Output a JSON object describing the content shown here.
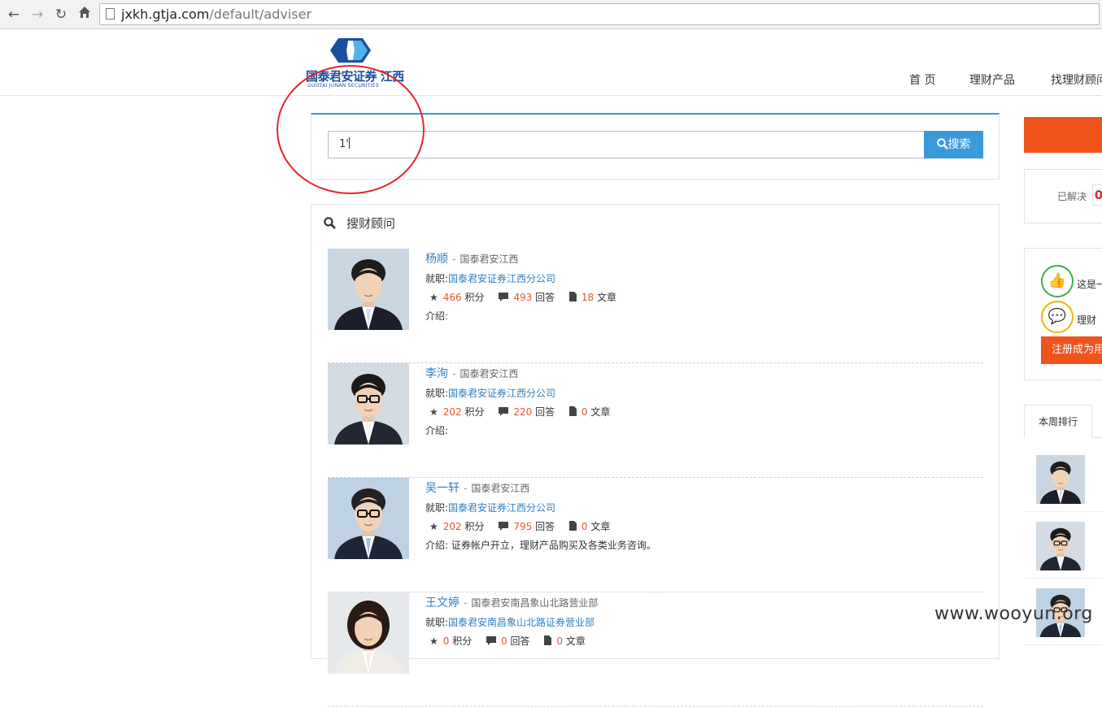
{
  "browser": {
    "url_host": "jxkh.gtja.com",
    "url_path": "/default/adviser"
  },
  "header": {
    "logo_name": "国泰君安证券 江西",
    "logo_sub": "GUOTAI JUNAN SECURITIES",
    "nav": [
      "首 页",
      "理财产品",
      "找理财顾问"
    ]
  },
  "search": {
    "value": "1'",
    "button_label": "搜索"
  },
  "results": {
    "title": "搜财顾问",
    "advisers": [
      {
        "name": "杨顺",
        "org": "国泰君安江西",
        "post_label": "就职:",
        "post": "国泰君安证券江西分公司",
        "points": "466",
        "points_label": "积分",
        "answers": "493",
        "answers_label": "回答",
        "articles": "18",
        "articles_label": "文章",
        "intro": "介绍:",
        "photo": {
          "bg": "#c9d6e2",
          "hair": "#1d1d1d",
          "suit": "#1c1f2b",
          "tie": "#c9ddee",
          "glasses": false
        }
      },
      {
        "name": "李洵",
        "org": "国泰君安江西",
        "post_label": "就职:",
        "post": "国泰君安证券江西分公司",
        "points": "202",
        "points_label": "积分",
        "answers": "220",
        "answers_label": "回答",
        "articles": "0",
        "articles_label": "文章",
        "intro": "介绍:",
        "photo": {
          "bg": "#d4dbe3",
          "hair": "#1a1a1a",
          "suit": "#222733",
          "tie": "#f2f2f2",
          "glasses": true
        }
      },
      {
        "name": "吴一轩",
        "org": "国泰君安江西",
        "post_label": "就职:",
        "post": "国泰君安证券江西分公司",
        "points": "202",
        "points_label": "积分",
        "answers": "795",
        "answers_label": "回答",
        "articles": "0",
        "articles_label": "文章",
        "intro": "介绍: 证券帐户开立，理财产品购买及各类业务咨询。",
        "photo": {
          "bg": "#bfd2e4",
          "hair": "#222",
          "suit": "#1e2636",
          "tie": "#9cc3e3",
          "glasses": true
        }
      },
      {
        "name": "王文婷",
        "org": "国泰君安南昌象山北路营业部",
        "post_label": "就职:",
        "post": "国泰君安南昌象山北路证券营业部",
        "points": "0",
        "points_label": "积分",
        "answers": "0",
        "answers_label": "回答",
        "articles": "0",
        "articles_label": "文章",
        "intro": "",
        "photo": {
          "bg": "#e6e9ec",
          "hair": "#2a1a14",
          "suit": "#f0ece6",
          "tie": "#f0ece6",
          "glasses": false
        }
      }
    ]
  },
  "sidebar": {
    "solved_label": "已解决",
    "solved_value": "0",
    "feature1": "这是一",
    "feature2": "理财",
    "register_label": "注册成为用",
    "rank_tab": "本周排行"
  },
  "watermark": "www.wooyun.org",
  "colors": {
    "accent": "#3a9ad9",
    "orange": "#f0531c",
    "link": "#2f7fc1",
    "number": "#e4572e",
    "annotation": "#e4262b"
  }
}
